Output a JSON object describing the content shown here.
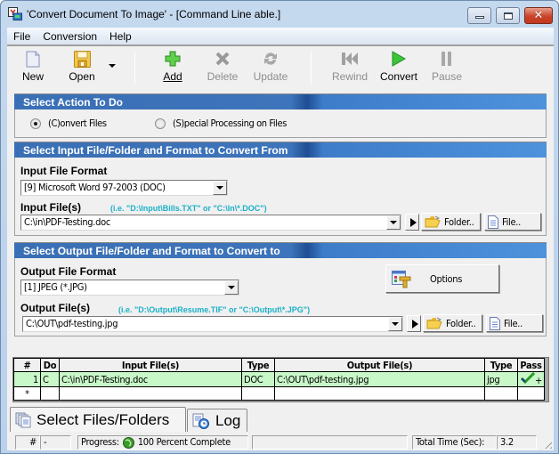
{
  "window": {
    "title": "'Convert Document To Image' - [Command Line able.]",
    "controls": {
      "minimize": "minimize",
      "maximize": "maximize",
      "close": "close"
    }
  },
  "menu": [
    {
      "label": "File"
    },
    {
      "label": "Conversion"
    },
    {
      "label": "Help"
    }
  ],
  "toolbar": {
    "new": {
      "label": "New",
      "icon": "new-document-icon",
      "enabled": true
    },
    "open": {
      "label": "Open",
      "icon": "floppy-disk-icon",
      "enabled": true
    },
    "add": {
      "label": "Add",
      "icon": "plus-icon",
      "enabled": true
    },
    "delete": {
      "label": "Delete",
      "icon": "x-icon",
      "enabled": false
    },
    "update": {
      "label": "Update",
      "icon": "refresh-icon",
      "enabled": false
    },
    "rewind": {
      "label": "Rewind",
      "icon": "rewind-icon",
      "enabled": false
    },
    "convert": {
      "label": "Convert",
      "icon": "play-icon",
      "enabled": true
    },
    "pause": {
      "label": "Pause",
      "icon": "pause-icon",
      "enabled": false
    }
  },
  "action_section": {
    "title": "Select Action To Do",
    "options": [
      {
        "label": "(C)onvert Files",
        "selected": true
      },
      {
        "label": "(S)pecial Processing on Files",
        "selected": false
      }
    ]
  },
  "input_section": {
    "title": "Select Input File/Folder and Format to Convert From",
    "format_label": "Input File Format",
    "format_value": "[9] Microsoft Word 97-2003 (DOC)",
    "files_label": "Input File(s)",
    "files_hint": "(i.e. \"D:\\Input\\Bills.TXT\"  or \"C:\\In\\*.DOC\")",
    "files_value": "C:\\in\\PDF-Testing.doc",
    "folder_button": "Folder..",
    "file_button": "File.."
  },
  "output_section": {
    "title": "Select Output File/Folder and Format to Convert to",
    "format_label": "Output File Format",
    "format_value": "[1] JPEG (*.JPG)",
    "options_button": "Options",
    "files_label": "Output File(s)",
    "files_hint": "(i.e. \"D:\\Output\\Resume.TIF\" or \"C:\\Output\\*.JPG\")",
    "files_value": "C:\\OUT\\pdf-testing.jpg",
    "folder_button": "Folder..",
    "file_button": "File.."
  },
  "grid": {
    "columns": [
      "#",
      "Do",
      "Input File(s)",
      "Type",
      "Output File(s)",
      "Type",
      "Pass"
    ],
    "rows": [
      {
        "num": "1",
        "do": "C",
        "input": "C:\\in\\PDF-Testing.doc",
        "in_type": "DOC",
        "output": "C:\\OUT\\pdf-testing.jpg",
        "out_type": "jpg",
        "pass": "+",
        "pass_icon": "checkmark-icon"
      }
    ],
    "new_row_marker": "*"
  },
  "tabs": [
    {
      "label": "Select Files/Folders",
      "active": true
    },
    {
      "label": "Log",
      "active": false
    }
  ],
  "status": {
    "hash_label": "#",
    "hash_value": "-",
    "progress_label": "Progress:",
    "progress_text": "100 Percent Complete",
    "progress_percent": 100,
    "total_time_label": "Total Time (Sec):",
    "total_time_value": "3.2"
  }
}
